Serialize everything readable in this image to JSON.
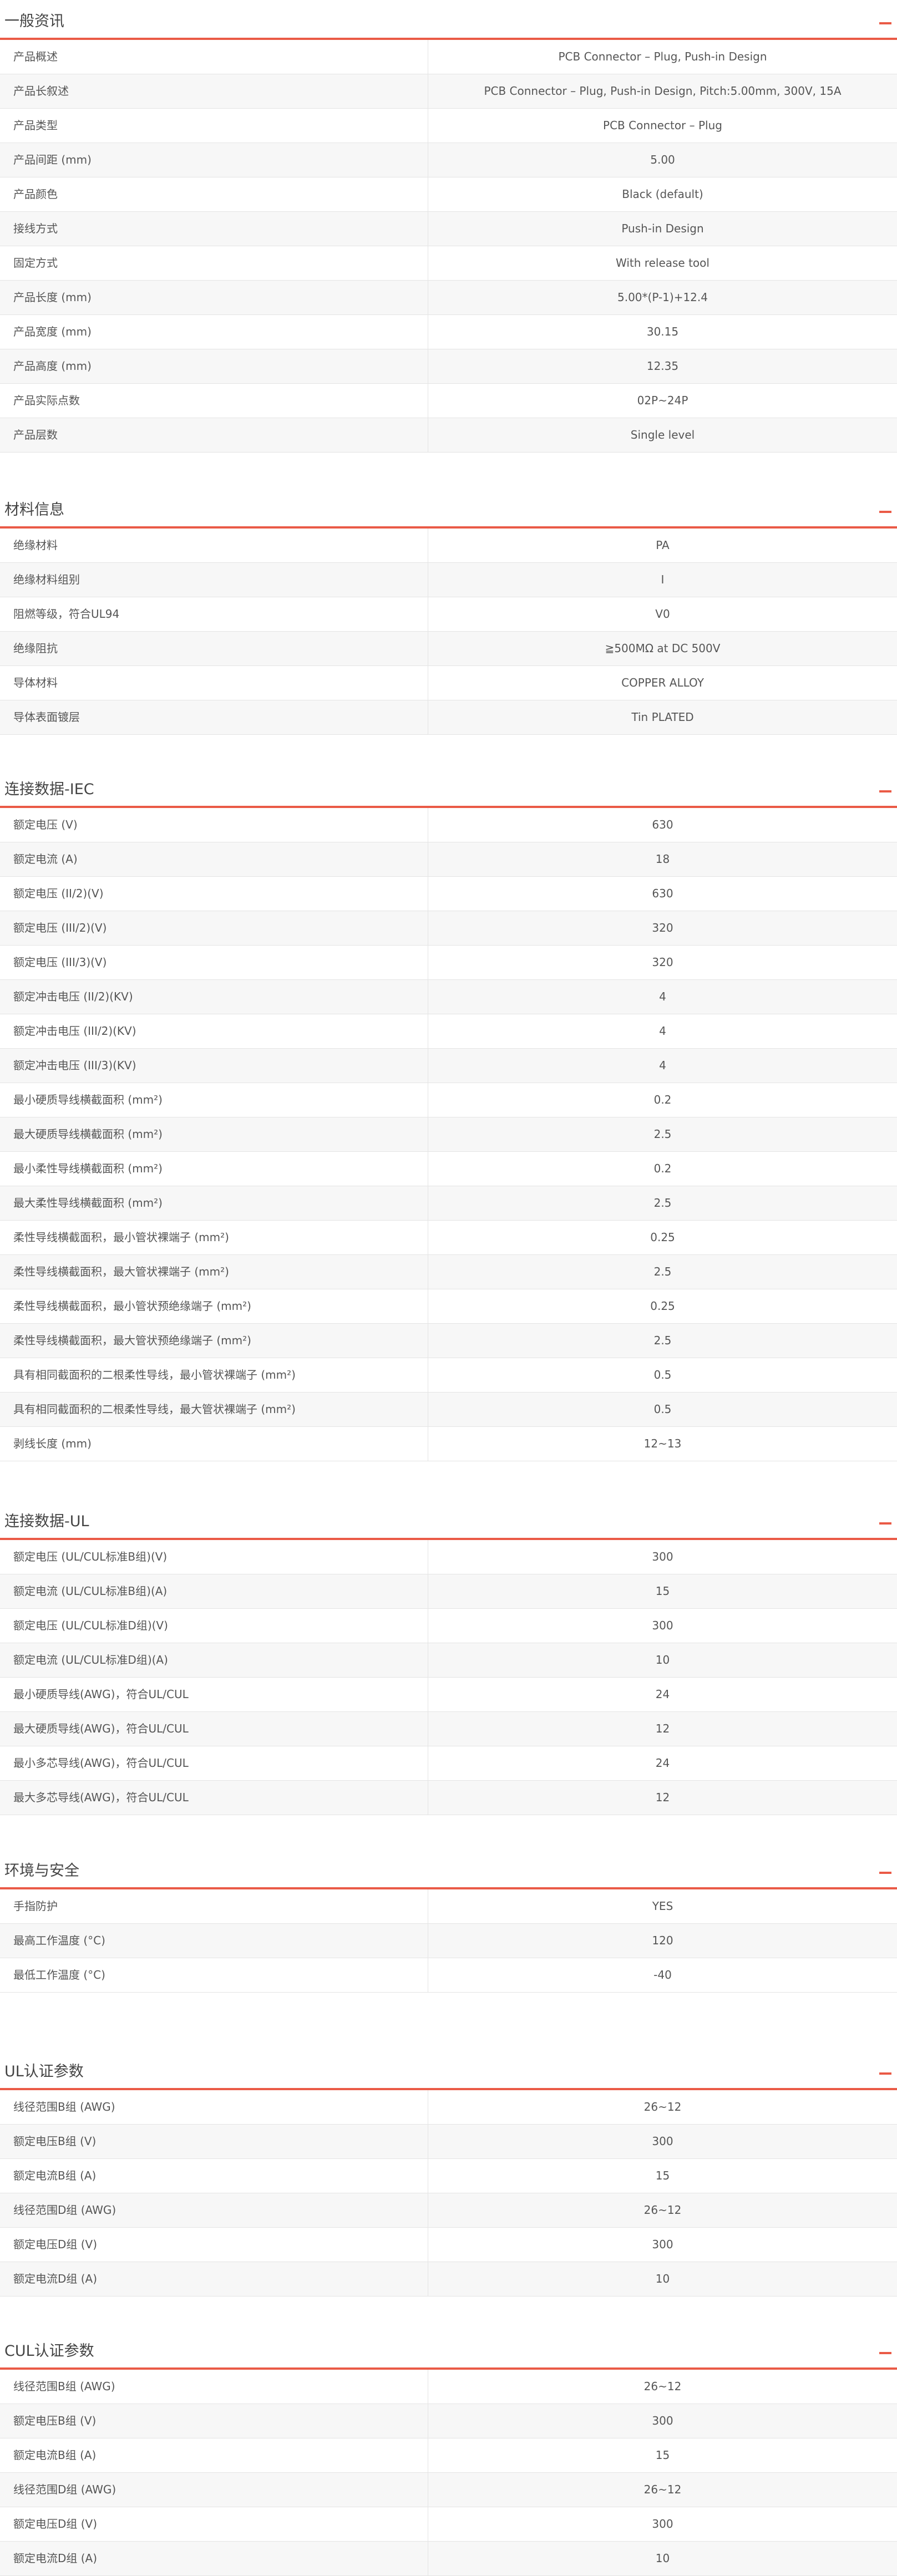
{
  "theme": {
    "accent": "#ea5a46",
    "row_alt": "#f7f7f7",
    "border": "#e4e4e4",
    "text": "#555555"
  },
  "sections": [
    {
      "title": "一般资讯",
      "collapse_icon": "minus-icon",
      "rows": [
        {
          "label": "产品概述",
          "value": "PCB Connector – Plug, Push-in Design"
        },
        {
          "label": "产品长叙述",
          "value": "PCB Connector – Plug, Push-in Design, Pitch:5.00mm, 300V, 15A"
        },
        {
          "label": "产品类型",
          "value": "PCB Connector – Plug"
        },
        {
          "label": "产品间距 (mm)",
          "value": "5.00"
        },
        {
          "label": "产品颜色",
          "value": "Black (default)"
        },
        {
          "label": "接线方式",
          "value": "Push-in Design"
        },
        {
          "label": "固定方式",
          "value": "With release tool"
        },
        {
          "label": "产品长度 (mm)",
          "value": "5.00*(P-1)+12.4"
        },
        {
          "label": "产品宽度 (mm)",
          "value": "30.15"
        },
        {
          "label": "产品高度 (mm)",
          "value": "12.35"
        },
        {
          "label": "产品实际点数",
          "value": "02P~24P"
        },
        {
          "label": "产品层数",
          "value": "Single level"
        }
      ]
    },
    {
      "title": "材料信息",
      "collapse_icon": "minus-icon",
      "rows": [
        {
          "label": "绝缘材料",
          "value": "PA"
        },
        {
          "label": "绝缘材料组别",
          "value": "I"
        },
        {
          "label": "阻燃等级，符合UL94",
          "value": "V0"
        },
        {
          "label": "绝缘阻抗",
          "value": "≧500MΩ at DC 500V"
        },
        {
          "label": "导体材料",
          "value": "COPPER ALLOY"
        },
        {
          "label": "导体表面镀层",
          "value": "Tin PLATED"
        }
      ]
    },
    {
      "title": "连接数据-IEC",
      "collapse_icon": "minus-icon",
      "rows": [
        {
          "label": "额定电压 (V)",
          "value": "630"
        },
        {
          "label": "额定电流 (A)",
          "value": "18"
        },
        {
          "label": "额定电压 (II/2)(V)",
          "value": "630"
        },
        {
          "label": "额定电压 (III/2)(V)",
          "value": "320"
        },
        {
          "label": "额定电压 (III/3)(V)",
          "value": "320"
        },
        {
          "label": "额定冲击电压 (II/2)(KV)",
          "value": "4"
        },
        {
          "label": "额定冲击电压 (III/2)(KV)",
          "value": "4"
        },
        {
          "label": "额定冲击电压 (III/3)(KV)",
          "value": "4"
        },
        {
          "label": "最小硬质导线横截面积 (mm²)",
          "value": "0.2"
        },
        {
          "label": "最大硬质导线横截面积 (mm²)",
          "value": "2.5"
        },
        {
          "label": "最小柔性导线横截面积 (mm²)",
          "value": "0.2"
        },
        {
          "label": "最大柔性导线横截面积 (mm²)",
          "value": "2.5"
        },
        {
          "label": "柔性导线横截面积，最小管状裸端子 (mm²)",
          "value": "0.25"
        },
        {
          "label": "柔性导线横截面积，最大管状裸端子 (mm²)",
          "value": "2.5"
        },
        {
          "label": "柔性导线横截面积，最小管状预绝缘端子 (mm²)",
          "value": "0.25"
        },
        {
          "label": "柔性导线横截面积，最大管状预绝缘端子 (mm²)",
          "value": "2.5"
        },
        {
          "label": "具有相同截面积的二根柔性导线，最小管状裸端子 (mm²)",
          "value": "0.5"
        },
        {
          "label": "具有相同截面积的二根柔性导线，最大管状裸端子 (mm²)",
          "value": "0.5"
        },
        {
          "label": "剥线长度 (mm)",
          "value": "12~13"
        }
      ]
    },
    {
      "title": "连接数据-UL",
      "collapse_icon": "minus-icon",
      "rows": [
        {
          "label": "额定电压 (UL/CUL标准B组)(V)",
          "value": "300"
        },
        {
          "label": "额定电流 (UL/CUL标准B组)(A)",
          "value": "15"
        },
        {
          "label": "额定电压 (UL/CUL标准D组)(V)",
          "value": "300"
        },
        {
          "label": "额定电流 (UL/CUL标准D组)(A)",
          "value": "10"
        },
        {
          "label": "最小硬质导线(AWG)，符合UL/CUL",
          "value": "24"
        },
        {
          "label": "最大硬质导线(AWG)，符合UL/CUL",
          "value": "12"
        },
        {
          "label": "最小多芯导线(AWG)，符合UL/CUL",
          "value": "24"
        },
        {
          "label": "最大多芯导线(AWG)，符合UL/CUL",
          "value": "12"
        }
      ]
    },
    {
      "title": "环境与安全",
      "collapse_icon": "minus-icon",
      "rows": [
        {
          "label": "手指防护",
          "value": "YES"
        },
        {
          "label": "最高工作温度 (°C)",
          "value": "120"
        },
        {
          "label": "最低工作温度 (°C)",
          "value": "-40"
        }
      ]
    },
    {
      "title": "UL认证参数",
      "collapse_icon": "minus-icon",
      "rows": [
        {
          "label": "线径范围B组 (AWG)",
          "value": "26~12"
        },
        {
          "label": "额定电压B组 (V)",
          "value": "300"
        },
        {
          "label": "额定电流B组 (A)",
          "value": "15"
        },
        {
          "label": "线径范围D组 (AWG)",
          "value": "26~12"
        },
        {
          "label": "额定电压D组 (V)",
          "value": "300"
        },
        {
          "label": "额定电流D组 (A)",
          "value": "10"
        }
      ]
    },
    {
      "title": "CUL认证参数",
      "collapse_icon": "minus-icon",
      "rows": [
        {
          "label": "线径范围B组 (AWG)",
          "value": "26~12"
        },
        {
          "label": "额定电压B组 (V)",
          "value": "300"
        },
        {
          "label": "额定电流B组 (A)",
          "value": "15"
        },
        {
          "label": "线径范围D组 (AWG)",
          "value": "26~12"
        },
        {
          "label": "额定电压D组 (V)",
          "value": "300"
        },
        {
          "label": "额定电流D组 (A)",
          "value": "10"
        }
      ]
    }
  ]
}
